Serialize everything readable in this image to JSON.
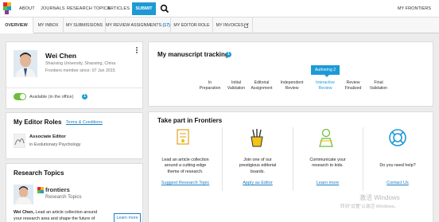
{
  "topnav": {
    "links": [
      "ABOUT",
      "JOURNALS",
      "RESEARCH TOPICS",
      "ARTICLES"
    ],
    "submit": "SUBMIT",
    "my_frontiers": "MY FRONTIERS"
  },
  "tabs": [
    {
      "label": "OVERVIEW",
      "count": ""
    },
    {
      "label": "MY INBOX",
      "count": ""
    },
    {
      "label": "MY SUBMISSIONS",
      "count": ""
    },
    {
      "label": "MY REVIEW ASSIGNMENTS",
      "count": "(17)"
    },
    {
      "label": "MY EDITOR ROLE",
      "count": ""
    },
    {
      "label": "MY INVOICES",
      "count": ""
    }
  ],
  "profile": {
    "name": "Wei Chen",
    "affiliation": "Shaoxing University, Shaoxing, China",
    "member_since": "Frontiers member since: 07 Jun 2015",
    "availability": "Available (in the office)",
    "availability_info": "1"
  },
  "editor_roles": {
    "title": "My Editor Roles",
    "terms": "Terms & Conditions",
    "role": "Associate Editor",
    "journal": "in Evolutionary Psychology"
  },
  "research_topics": {
    "title": "Research Topics",
    "brand": "frontiers",
    "brand_sub": "Research Topics",
    "text_name": "Wei Chen,",
    "text_line1": "Lead an article collection around",
    "text_line2": "your research area and shape the future of",
    "learn_more": "Learn more"
  },
  "tracking": {
    "title": "My manuscript tracking",
    "info": "1",
    "badge": "Authoring 2",
    "steps": [
      {
        "l1": "In",
        "l2": "Preparation"
      },
      {
        "l1": "Initial",
        "l2": "Validation"
      },
      {
        "l1": "Editorial",
        "l2": "Assignment"
      },
      {
        "l1": "Independent",
        "l2": "Review"
      },
      {
        "l1": "Interactive",
        "l2": "Review"
      },
      {
        "l1": "Review",
        "l2": "Finalized"
      },
      {
        "l1": "Final",
        "l2": "Validation"
      }
    ]
  },
  "take_part": {
    "title": "Take part in Frontiers",
    "items": [
      {
        "l1": "Lead an article collection",
        "l2": "around a cutting-edge",
        "l3": "theme of research.",
        "link": "Suggest Research Topic",
        "icon": "research-topic-icon"
      },
      {
        "l1": "Join one of our",
        "l2": "prestigious editorial",
        "l3": "boards.",
        "link": "Apply as Editor",
        "icon": "pencil-cup-icon"
      },
      {
        "l1": "Communicate your",
        "l2": "research to kids.",
        "l3": "",
        "link": "Learn more",
        "icon": "kids-icon"
      },
      {
        "l1": "Do you need help?",
        "l2": "",
        "l3": "",
        "link": "Contact Us",
        "icon": "lifebuoy-icon"
      }
    ]
  },
  "watermark": {
    "line1": "激活 Windows",
    "line2": "转到\"设置\"以激活 Windows。"
  },
  "colors": {
    "accent": "#1d9ad6",
    "link": "#1d7ec2",
    "toggle": "#6cbf3a"
  }
}
